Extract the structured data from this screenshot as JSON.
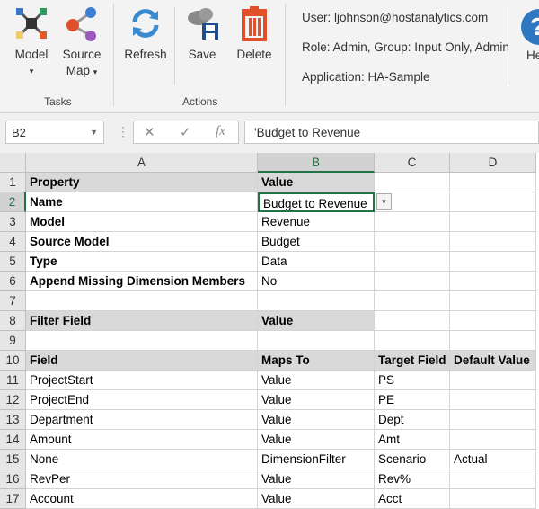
{
  "ribbon": {
    "tasks": {
      "label": "Tasks",
      "model": "Model",
      "source_map_1": "Source",
      "source_map_2": "Map"
    },
    "actions": {
      "label": "Actions",
      "refresh": "Refresh",
      "save": "Save",
      "delete": "Delete"
    },
    "info": {
      "user": "User: ljohnson@hostanalytics.com",
      "role": "Role: Admin, Group: Input Only, Admin",
      "application": "Application: HA-Sample"
    },
    "help": "He"
  },
  "formula_bar": {
    "name_box": "B2",
    "formula": "'Budget to Revenue"
  },
  "columns": [
    "A",
    "B",
    "C",
    "D"
  ],
  "rows": [
    [
      "Property",
      "Value",
      "",
      ""
    ],
    [
      "Name",
      "Budget to Revenue",
      "",
      ""
    ],
    [
      "Model",
      "Revenue",
      "",
      ""
    ],
    [
      "Source Model",
      "Budget",
      "",
      ""
    ],
    [
      "Type",
      "Data",
      "",
      ""
    ],
    [
      "Append Missing Dimension Members",
      "No",
      "",
      ""
    ],
    [
      "",
      "",
      "",
      ""
    ],
    [
      "Filter Field",
      "Value",
      "",
      ""
    ],
    [
      "",
      "",
      "",
      ""
    ],
    [
      "Field",
      "Maps To",
      "Target Field",
      "Default Value"
    ],
    [
      "ProjectStart",
      "Value",
      "PS",
      ""
    ],
    [
      "ProjectEnd",
      "Value",
      "PE",
      ""
    ],
    [
      "Department",
      "Value",
      "Dept",
      ""
    ],
    [
      "Amount",
      "Value",
      "Amt",
      ""
    ],
    [
      "None",
      "DimensionFilter",
      "Scenario",
      "Actual"
    ],
    [
      "RevPer",
      "Value",
      "Rev%",
      ""
    ],
    [
      "Account",
      "Value",
      "Acct",
      ""
    ]
  ],
  "selected_cell": "B2",
  "accent": "#217346"
}
